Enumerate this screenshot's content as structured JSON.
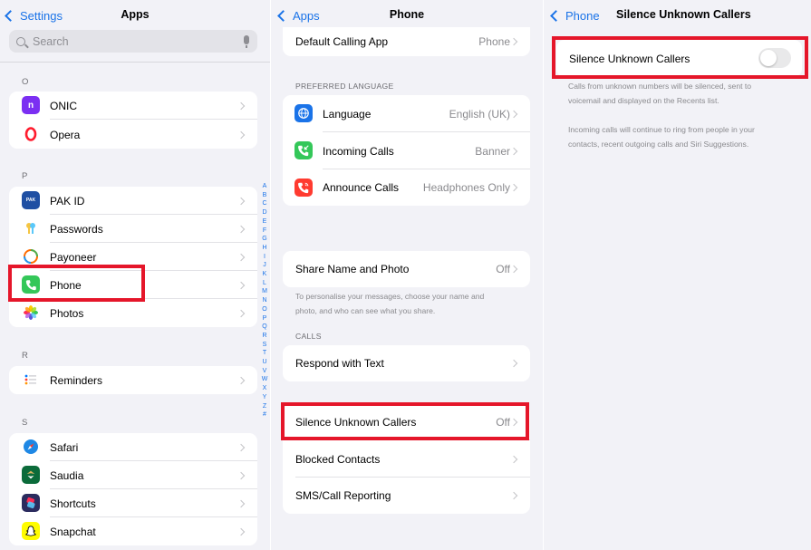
{
  "panel1": {
    "back_label": "Settings",
    "title": "Apps",
    "search_placeholder": "Search",
    "sections": [
      {
        "letter": "O",
        "apps": [
          {
            "name": "ONIC",
            "icon": "onic-icon",
            "color": "#8a2be2"
          },
          {
            "name": "Opera",
            "icon": "opera-icon",
            "color": "#ff1b2d"
          }
        ]
      },
      {
        "letter": "P",
        "apps": [
          {
            "name": "PAK ID",
            "icon": "pakid-icon",
            "color": "#1f4fa3"
          },
          {
            "name": "Passwords",
            "icon": "key-icon",
            "color": "#f5c542"
          },
          {
            "name": "Payoneer",
            "icon": "payoneer-icon",
            "color": "#ff6b00"
          },
          {
            "name": "Phone",
            "icon": "phone-icon",
            "color": "#34c759"
          },
          {
            "name": "Photos",
            "icon": "photos-icon",
            "color": "#ff9500"
          }
        ]
      },
      {
        "letter": "R",
        "apps": [
          {
            "name": "Reminders",
            "icon": "reminders-icon",
            "color": "#ffffff"
          }
        ]
      },
      {
        "letter": "S",
        "apps": [
          {
            "name": "Safari",
            "icon": "safari-icon",
            "color": "#1e88e5"
          },
          {
            "name": "Saudia",
            "icon": "saudia-icon",
            "color": "#0b6b3a"
          },
          {
            "name": "Shortcuts",
            "icon": "shortcuts-icon",
            "color": "#5b3df5"
          },
          {
            "name": "Snapchat",
            "icon": "snapchat-icon",
            "color": "#fffc00"
          }
        ]
      }
    ],
    "index_letters": [
      "A",
      "B",
      "C",
      "D",
      "E",
      "F",
      "G",
      "H",
      "I",
      "J",
      "K",
      "L",
      "M",
      "N",
      "O",
      "P",
      "Q",
      "R",
      "S",
      "T",
      "U",
      "V",
      "W",
      "X",
      "Y",
      "Z",
      "#"
    ]
  },
  "panel2": {
    "back_label": "Apps",
    "title": "Phone",
    "default_calling_app": {
      "label": "Default Calling App",
      "value": "Phone"
    },
    "preferred_language_header": "PREFERRED LANGUAGE",
    "language_rows": [
      {
        "label": "Language",
        "value": "English (UK)",
        "icon": "globe-icon",
        "color": "#1a73e8"
      },
      {
        "label": "Incoming Calls",
        "value": "Banner",
        "icon": "incoming-call-icon",
        "color": "#34c759"
      },
      {
        "label": "Announce Calls",
        "value": "Headphones Only",
        "icon": "announce-call-icon",
        "color": "#ff3b30"
      }
    ],
    "share_name": {
      "label": "Share Name and Photo",
      "value": "Off"
    },
    "share_caption_line1": "To personalise your messages, choose your name and",
    "share_caption_line2": "photo, and who can see what you share.",
    "calls_header": "CALLS",
    "respond_with_text": "Respond with Text",
    "silence_unknown": {
      "label": "Silence Unknown Callers",
      "value": "Off"
    },
    "blocked_contacts": "Blocked Contacts",
    "sms_reporting": "SMS/Call Reporting"
  },
  "panel3": {
    "back_label": "Phone",
    "title": "Silence Unknown Callers",
    "toggle_label": "Silence Unknown Callers",
    "toggle_on": false,
    "caption1_line1": "Calls from unknown numbers will be silenced, sent to",
    "caption1_line2": "voicemail and displayed on the Recents list.",
    "caption2_line1": "Incoming calls will continue to ring from people in your",
    "caption2_line2": "contacts, recent outgoing calls and Siri Suggestions."
  },
  "colors": {
    "accent": "#1a73e8",
    "highlight": "#e5162a",
    "background": "#f2f2f7"
  }
}
